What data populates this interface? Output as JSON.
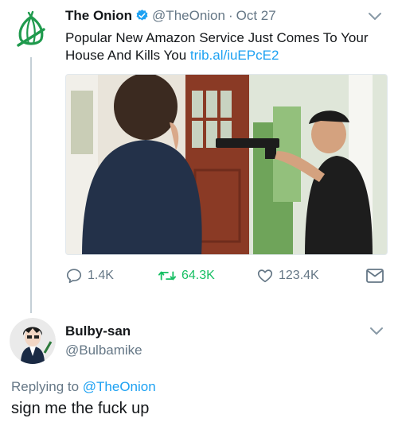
{
  "tweet": {
    "display_name": "The Onion",
    "handle": "@TheOnion",
    "separator": "·",
    "date": "Oct 27",
    "text": "Popular New Amazon Service Just Comes To Your House And Kills You ",
    "link": "trib.al/iuEPcE2",
    "avatar_icon": "onion-logo-icon",
    "verified_icon": "verified-badge-icon",
    "verified_color": "#1da1f2",
    "brand_color": "#1f9a4d",
    "actions": {
      "replies": "1.4K",
      "retweets": "64.3K",
      "likes": "123.4K"
    }
  },
  "reply": {
    "display_name": "Bulby-san",
    "handle": "@Bulbamike",
    "replying_prefix": "Replying to ",
    "replying_to": "@TheOnion",
    "text": "sign me the fuck up"
  },
  "colors": {
    "muted": "#657786",
    "link": "#1da1f2",
    "retweet": "#17bf63",
    "thread_line": "#c4cfd6"
  }
}
